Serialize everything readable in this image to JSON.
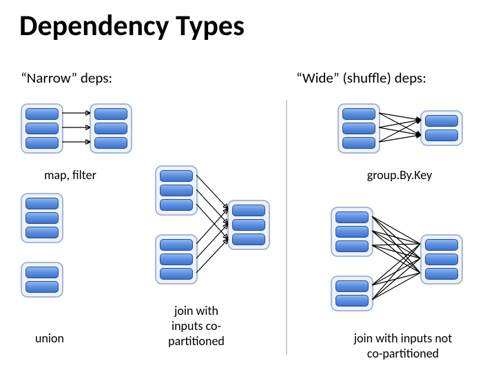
{
  "title": "Dependency Types",
  "narrow_label": "“Narrow” deps:",
  "wide_label": "“Wide” (shuffle) deps:",
  "map_filter": "map, filter",
  "union": "union",
  "join_copart": "join with\ninputs co-\npartitioned",
  "groupbykey": "group.By.Key",
  "join_notcopart": "join with inputs not\nco-partitioned"
}
